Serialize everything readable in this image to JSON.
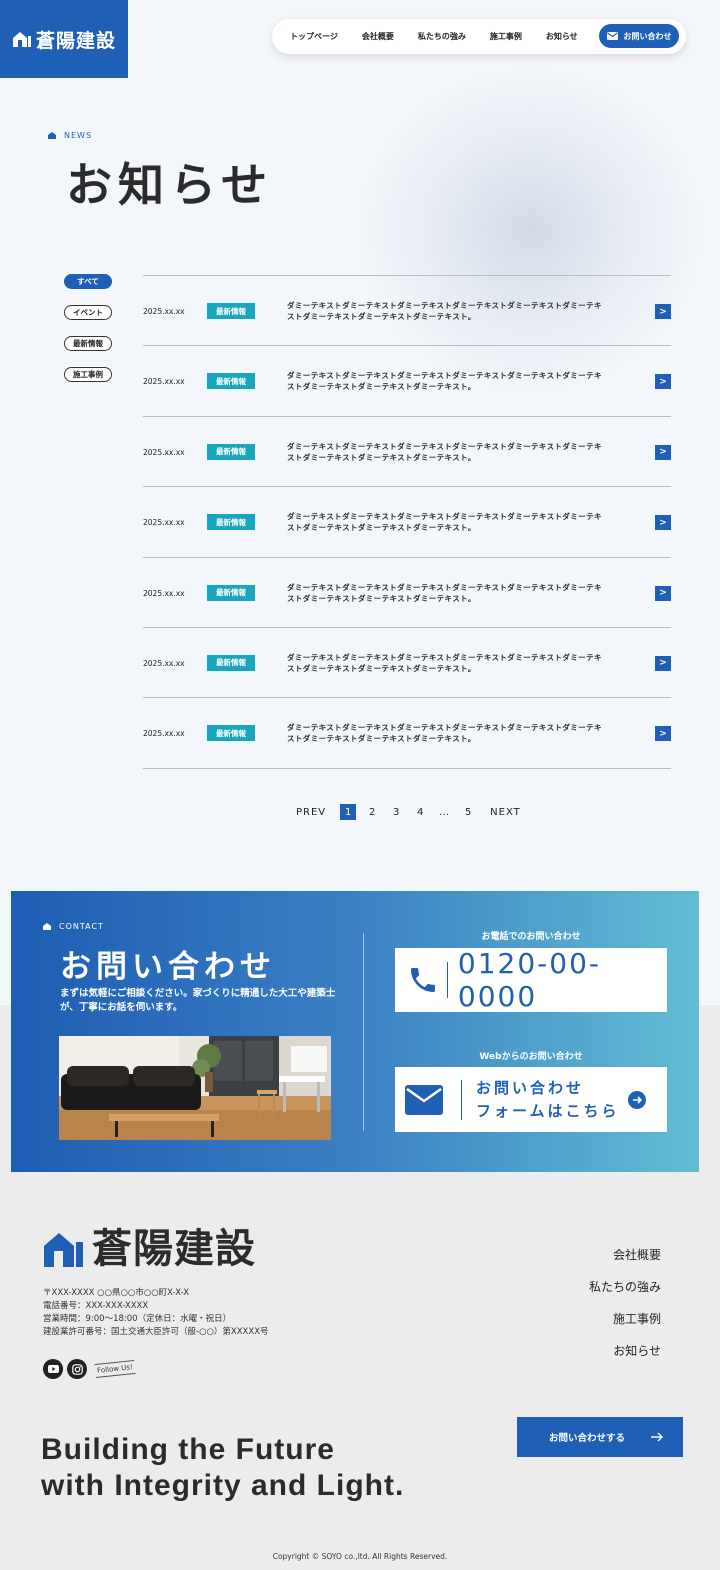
{
  "header": {
    "logo_text": "蒼陽建設",
    "nav": [
      "トップページ",
      "会社概要",
      "私たちの強み",
      "施工事例",
      "お知らせ"
    ],
    "contact_label": "お問い合わせ"
  },
  "heading": {
    "label": "NEWS",
    "title": "お知らせ"
  },
  "filters": [
    "すべて",
    "イベント",
    "最新情報",
    "施工事例"
  ],
  "news": [
    {
      "date": "2025.xx.xx",
      "tag": "最新情報",
      "text": "ダミーテキストダミーテキストダミーテキストダミーテキストダミーテキストダミーテキストダミーテキストダミーテキストダミーテキスト。",
      "arrow": ">"
    },
    {
      "date": "2025.xx.xx",
      "tag": "最新情報",
      "text": "ダミーテキストダミーテキストダミーテキストダミーテキストダミーテキストダミーテキストダミーテキストダミーテキストダミーテキスト。",
      "arrow": ">"
    },
    {
      "date": "2025.xx.xx",
      "tag": "最新情報",
      "text": "ダミーテキストダミーテキストダミーテキストダミーテキストダミーテキストダミーテキストダミーテキストダミーテキストダミーテキスト。",
      "arrow": ">"
    },
    {
      "date": "2025.xx.xx",
      "tag": "最新情報",
      "text": "ダミーテキストダミーテキストダミーテキストダミーテキストダミーテキストダミーテキストダミーテキストダミーテキストダミーテキスト。",
      "arrow": ">"
    },
    {
      "date": "2025.xx.xx",
      "tag": "最新情報",
      "text": "ダミーテキストダミーテキストダミーテキストダミーテキストダミーテキストダミーテキストダミーテキストダミーテキストダミーテキスト。",
      "arrow": ">"
    },
    {
      "date": "2025.xx.xx",
      "tag": "最新情報",
      "text": "ダミーテキストダミーテキストダミーテキストダミーテキストダミーテキストダミーテキストダミーテキストダミーテキストダミーテキスト。",
      "arrow": ">"
    },
    {
      "date": "2025.xx.xx",
      "tag": "最新情報",
      "text": "ダミーテキストダミーテキストダミーテキストダミーテキストダミーテキストダミーテキストダミーテキストダミーテキストダミーテキスト。",
      "arrow": ">"
    }
  ],
  "pagination": {
    "prev": "PREV",
    "pages": [
      "1",
      "2",
      "3",
      "4"
    ],
    "ellipsis": "…",
    "last": "5",
    "next": "NEXT",
    "current": "1"
  },
  "contact": {
    "label": "CONTACT",
    "title": "お問い合わせ",
    "description": "まずは気軽にご相談ください。家づくりに精通した大工や建築士が、丁寧にお話を伺います。",
    "phone_caption": "お電話でのお問い合わせ",
    "phone_number": "0120-00-0000",
    "web_caption": "Webからのお問い合わせ",
    "form_line1": "お問い合わせ",
    "form_line2": "フォームはこちら"
  },
  "footer": {
    "logo_text": "蒼陽建設",
    "info": [
      "〒XXX-XXXX ○○県○○市○○町X-X-X",
      "電話番号：XXX-XXX-XXXX",
      "営業時間：9:00〜18:00（定休日：水曜・祝日）",
      "建設業許可番号：国土交通大臣許可（般-○○）第XXXXX号"
    ],
    "follow": "Follow Us!",
    "nav": [
      "会社概要",
      "私たちの強み",
      "施工事例",
      "お知らせ"
    ],
    "tagline_line1": "Building the Future",
    "tagline_line2": "with Integrity and Light.",
    "cta_label": "お問い合わせする",
    "copyright": "Copyright © SOYO co.,ltd. All Rights Reserved."
  },
  "colors": {
    "brand_blue": "#1f5fb5",
    "tag_teal": "#18a5bd",
    "gradient_end": "#61bdd3"
  },
  "icons": [
    "logo-house-icon",
    "mail-icon",
    "phone-icon",
    "arrow-right-circle-icon",
    "youtube-icon",
    "instagram-icon",
    "arrow-right-icon"
  ]
}
